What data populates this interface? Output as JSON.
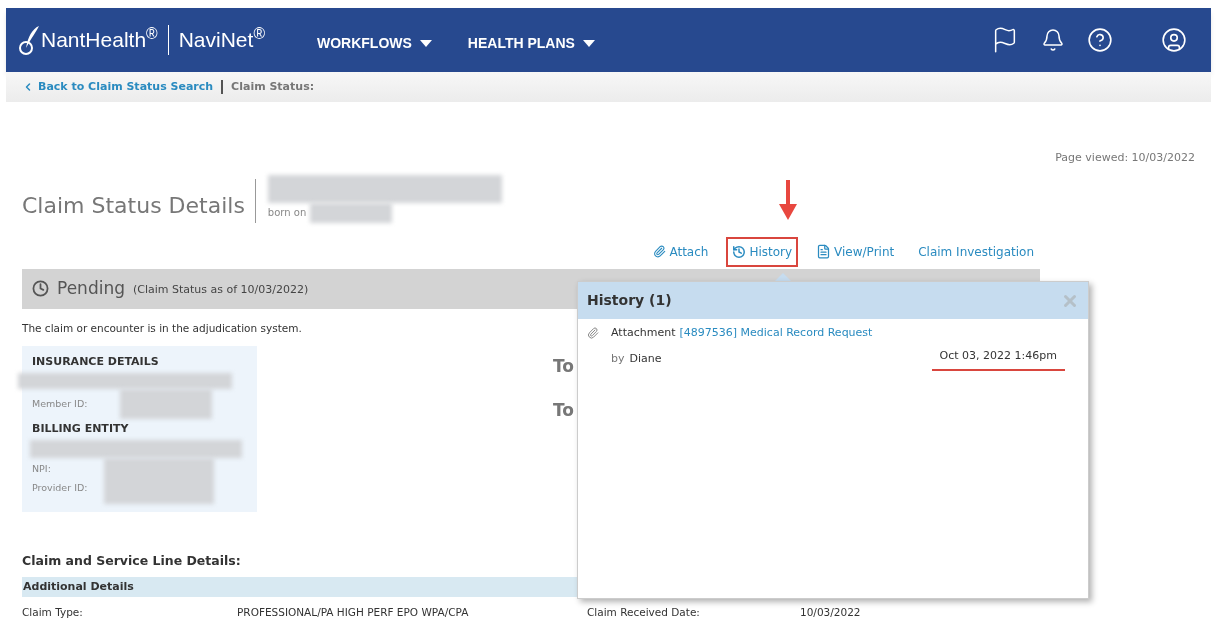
{
  "header": {
    "brand": "NantHealth$^{®}$",
    "product": "NaviNet$^{®}$",
    "menus": [
      {
        "label": "WORKFLOWS"
      },
      {
        "label": "HEALTH PLANS"
      }
    ]
  },
  "breadcrumb": {
    "back_link": "Back to Claim Status Search",
    "current": "Claim Status:"
  },
  "page_viewed": "Page viewed: 10/03/2022",
  "title": "Claim Status Details",
  "born_on": "born on",
  "actions": [
    {
      "kind": "attach",
      "label": "Attach",
      "highlighted": false
    },
    {
      "kind": "history",
      "label": "History",
      "highlighted": true
    },
    {
      "kind": "pdf",
      "label": "View/Print",
      "highlighted": false
    },
    {
      "kind": "plain",
      "label": "Claim Investigation",
      "highlighted": false
    }
  ],
  "status": {
    "label": "Pending",
    "as_of": "(Claim Status as of 10/03/2022)",
    "description": "The claim or encounter is in the adjudication system."
  },
  "insurance": {
    "heading": "INSURANCE DETAILS",
    "fields": [
      {
        "label": "Member ID:"
      }
    ]
  },
  "billing": {
    "heading": "BILLING ENTITY",
    "fields": [
      {
        "label": "NPI:"
      },
      {
        "label": "Provider ID:"
      }
    ]
  },
  "totals": [
    "To",
    "To"
  ],
  "details": {
    "title": "Claim and Service Line Details:",
    "section": "Additional Details",
    "rows": [
      [
        {
          "label": "Claim Type:",
          "value": "PROFESSIONAL/PA HIGH PERF EPO WPA/CPA"
        },
        {
          "label": "Claim Received Date:",
          "value": "10/03/2022"
        }
      ]
    ]
  },
  "history_popup": {
    "title": "History (1)",
    "entries": [
      {
        "type": "Attachment",
        "link": "[4897536] Medical Record Request",
        "by": "by",
        "author": "Diane",
        "date": "Oct 03, 2022 1:46pm",
        "underlined": true
      }
    ]
  }
}
